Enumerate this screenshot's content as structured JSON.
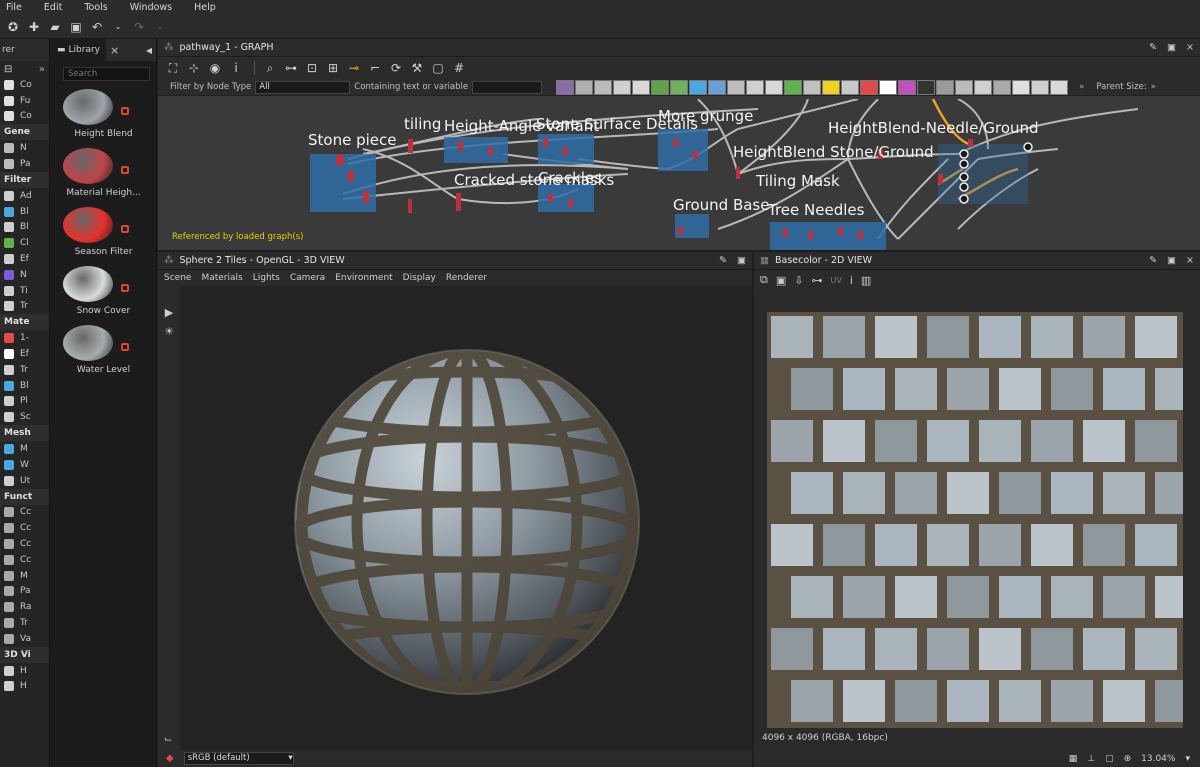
{
  "menu": [
    "File",
    "Edit",
    "Tools",
    "Windows",
    "Help"
  ],
  "explorer": {
    "tab_label": "rer",
    "sections": [
      {
        "header": "",
        "items": [
          "Co",
          "Fu",
          "Co"
        ],
        "colors": [
          "#e0e0e0",
          "#e0e0e0",
          "#e0e0e0"
        ]
      },
      {
        "header": "Gene",
        "items": [
          "N",
          "Pa"
        ],
        "colors": [
          "#bbbbbb",
          "#bbbbbb"
        ]
      },
      {
        "header": "Filter",
        "items": [
          "Ad",
          "Bl",
          "Bl",
          "Cl",
          "Ef",
          "N",
          "Ti",
          "Tr"
        ],
        "colors": [
          "#cfcfcf",
          "#4aa8e0",
          "#cfcfcf",
          "#5fb34a",
          "#cfcfcf",
          "#7a5be0",
          "#cfcfcf",
          "#cfcfcf"
        ]
      },
      {
        "header": "Mate",
        "items": [
          "1-",
          "Ef",
          "Tr",
          "Bl",
          "Pl",
          "Sc"
        ],
        "colors": [
          "#e04a4a",
          "#ffffff",
          "#cfcfcf",
          "#4aa8e0",
          "#cfcfcf",
          "#cfcfcf"
        ]
      },
      {
        "header": "Mesh",
        "items": [
          "M",
          "W",
          "Ut"
        ],
        "colors": [
          "#4aa8e0",
          "#4aa8e0",
          "#cfcfcf"
        ]
      },
      {
        "header": "Funct",
        "items": [
          "Cc",
          "Cc",
          "Cc",
          "Cc",
          "M",
          "Pa",
          "Ra",
          "Tr",
          "Va"
        ],
        "colors": [
          "#aaaaaa",
          "#aaaaaa",
          "#aaaaaa",
          "#aaaaaa",
          "#aaaaaa",
          "#aaaaaa",
          "#aaaaaa",
          "#aaaaaa",
          "#aaaaaa"
        ]
      },
      {
        "header": "3D Vi",
        "items": [
          "H",
          "H"
        ],
        "colors": [
          "#cfcfcf",
          "#cfcfcf"
        ]
      }
    ]
  },
  "library": {
    "tab_label": "Library",
    "search_placeholder": "Search",
    "items": [
      {
        "label": "Height Blend",
        "color": "#9ea4aa"
      },
      {
        "label": "Material Heigh...",
        "color": "#c0444a"
      },
      {
        "label": "Season Filter",
        "color": "#e8302a"
      },
      {
        "label": "Snow Cover",
        "color": "#d8dbdd"
      },
      {
        "label": "Water Level",
        "color": "#a8acae"
      }
    ]
  },
  "graph": {
    "title": "pathway_1 - GRAPH",
    "filter_label": "Filter by Node Type",
    "filter_value": "All",
    "containing_label": "Containing text or variable",
    "parent_size_label": "Parent Size:",
    "referenced_note": "Referenced by loaded graph(s)",
    "frames": [
      "Stone piece",
      "tiling",
      "Height-Angle variant",
      "Stone Surface Details",
      "More grunge",
      "HeightBlend-Needle/Ground",
      "HeightBlend Stone/Ground",
      "Cracked stone masks",
      "Crackles",
      "Tiling Mask",
      "Ground Base",
      "Tree Needles"
    ]
  },
  "view3d": {
    "title": "Sphere 2 Tiles - OpenGL - 3D VIEW",
    "menu": [
      "Scene",
      "Materials",
      "Lights",
      "Camera",
      "Environment",
      "Display",
      "Renderer"
    ],
    "colorspace": "sRGB (default)"
  },
  "view2d": {
    "title": "Basecolor - 2D VIEW",
    "uv_label": "UV",
    "info": "4096 x 4096 (RGBA, 16bpc)",
    "zoom": "13.04%"
  }
}
